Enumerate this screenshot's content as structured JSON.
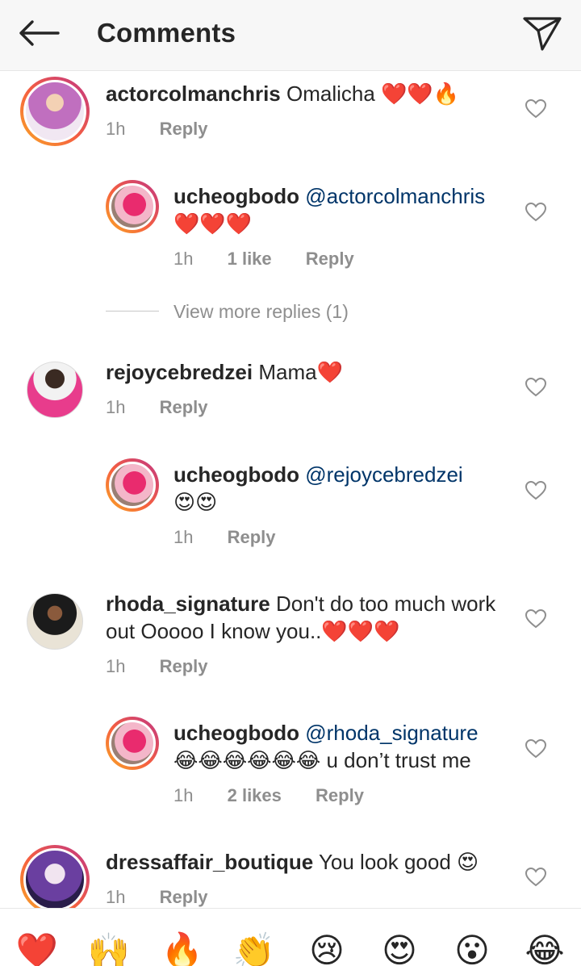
{
  "header": {
    "title": "Comments"
  },
  "comments": [
    {
      "user": "actorcolmanchris",
      "text": "Omalicha",
      "emoji": "❤️❤️🔥",
      "time": "1h",
      "reply": "Reply",
      "replies": [
        {
          "user": "ucheogbodo",
          "mention": "@actorcolmanchris",
          "text": "❤️❤️❤️",
          "time": "1h",
          "likes": "1 like",
          "reply": "Reply"
        }
      ],
      "view_more": "View more replies (1)"
    },
    {
      "user": "rejoycebredzei",
      "text": "Mama",
      "emoji": "❤️",
      "time": "1h",
      "reply": "Reply",
      "replies": [
        {
          "user": "ucheogbodo",
          "mention": "@rejoycebredzei",
          "text": "😍😍",
          "time": "1h",
          "reply": "Reply"
        }
      ]
    },
    {
      "user": "rhoda_signature",
      "text": "Don't do too much work out Ooooo I know you..",
      "emoji": "❤️❤️❤️",
      "time": "1h",
      "reply": "Reply",
      "replies": [
        {
          "user": "ucheogbodo",
          "mention": "@rhoda_signature",
          "text": "😂😂😂😂😂😂 u don’t trust me",
          "time": "1h",
          "likes": "2 likes",
          "reply": "Reply"
        }
      ]
    },
    {
      "user": "dressaffair_boutique",
      "text": "You look good",
      "emoji": "😍",
      "time": "1h",
      "reply": "Reply"
    }
  ],
  "emoji_bar": [
    "❤️",
    "🙌",
    "🔥",
    "👏",
    "😢",
    "😍",
    "😮",
    "😂"
  ],
  "colors": {
    "mention": "#003569",
    "meta": "#8e8e8e",
    "text": "#262626",
    "ring_gradient": [
      "#f9a825",
      "#f56040",
      "#c13584"
    ]
  }
}
